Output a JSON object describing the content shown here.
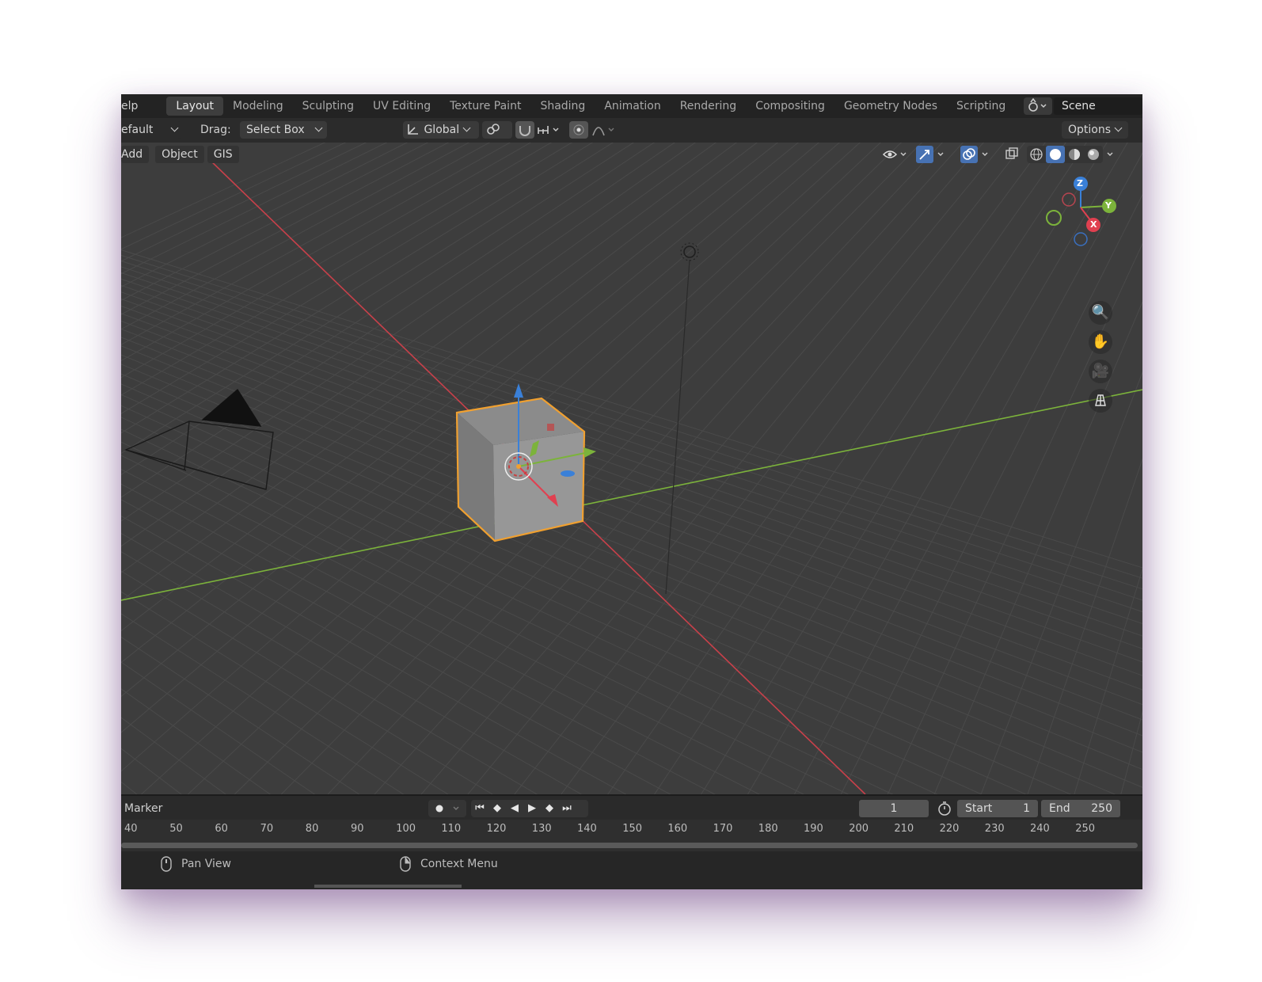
{
  "topbar": {
    "menu_fragment": "elp",
    "tabs": [
      {
        "label": "Layout",
        "active": true
      },
      {
        "label": "Modeling"
      },
      {
        "label": "Sculpting"
      },
      {
        "label": "UV Editing"
      },
      {
        "label": "Texture Paint"
      },
      {
        "label": "Shading"
      },
      {
        "label": "Animation"
      },
      {
        "label": "Rendering"
      },
      {
        "label": "Compositing"
      },
      {
        "label": "Geometry Nodes"
      },
      {
        "label": "Scripting"
      }
    ],
    "add_tab": "+",
    "scene": "Scene"
  },
  "toolbar": {
    "mode_fragment": "efault",
    "drag_label": "Drag:",
    "drag_value": "Select Box",
    "orientation": "Global",
    "options": "Options"
  },
  "header": {
    "menus": [
      "Add",
      "Object",
      "GIS"
    ]
  },
  "gizmo": {
    "z": "Z",
    "y": "Y",
    "x": "X"
  },
  "timeline": {
    "marker": "Marker",
    "current_frame": "1",
    "start_label": "Start",
    "start_value": "1",
    "end_label": "End",
    "end_value": "250",
    "ticks": [
      "40",
      "50",
      "60",
      "70",
      "80",
      "90",
      "100",
      "110",
      "120",
      "130",
      "140",
      "150",
      "160",
      "170",
      "180",
      "190",
      "200",
      "210",
      "220",
      "230",
      "240",
      "250"
    ]
  },
  "status": {
    "pan": "Pan View",
    "context": "Context Menu"
  },
  "colors": {
    "x_axis": "#c8404a",
    "y_axis": "#7cb33b",
    "selection": "#f0a030",
    "gizmo_z": "#3a80d8"
  }
}
